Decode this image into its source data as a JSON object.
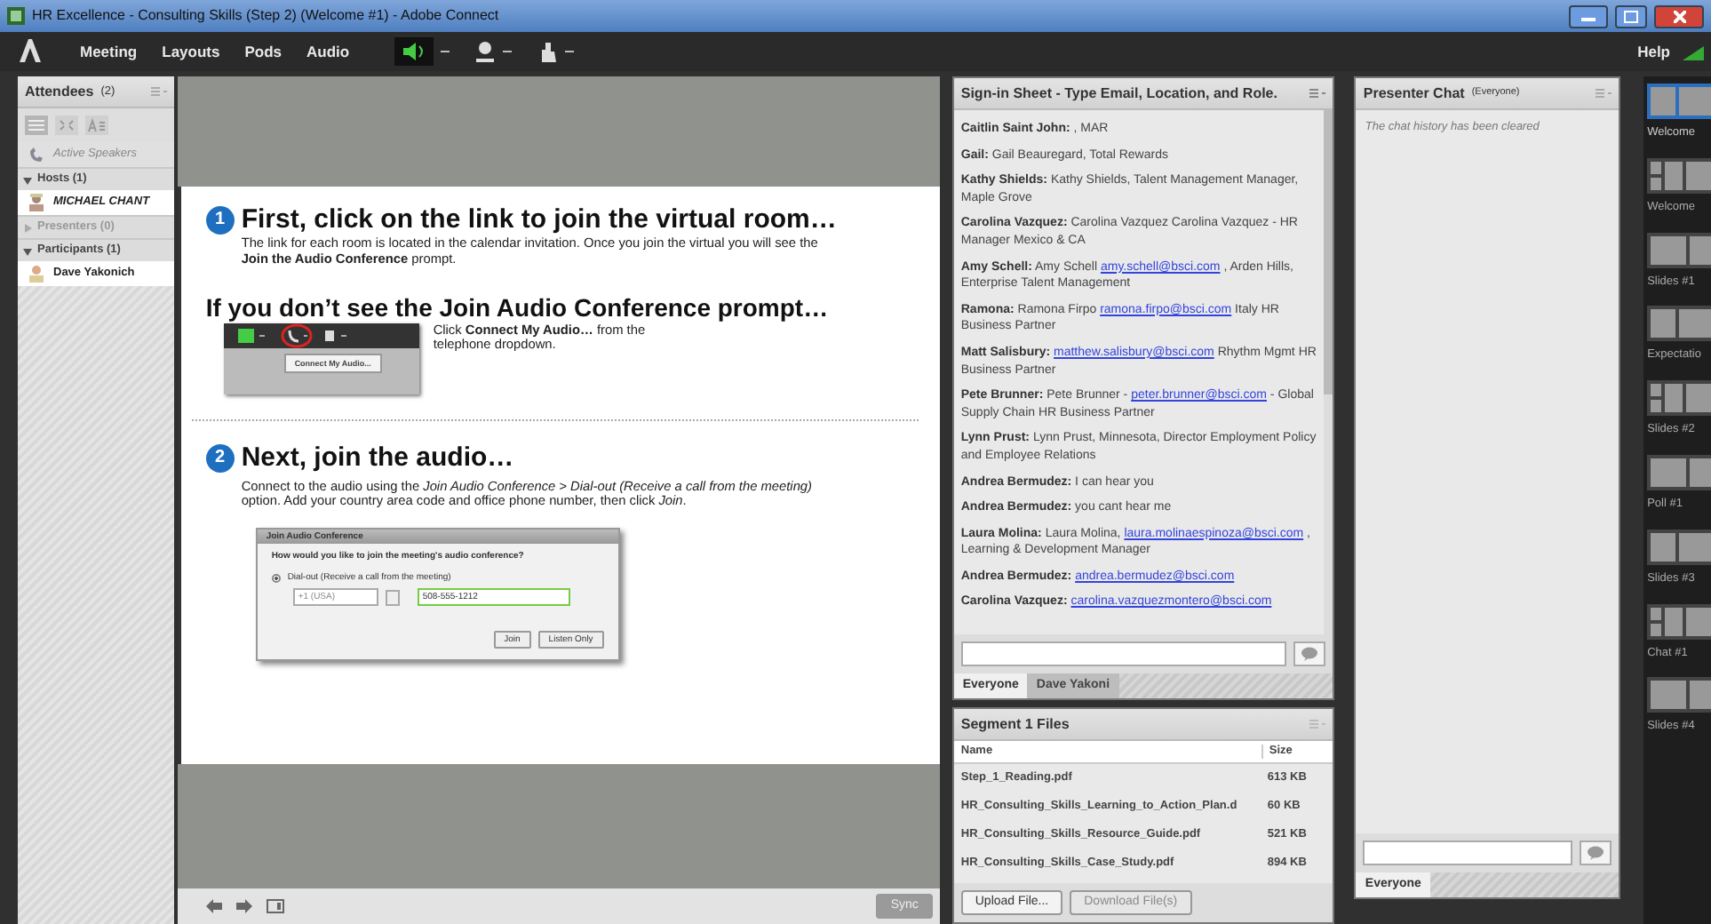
{
  "window": {
    "title": "HR Excellence - Consulting Skills (Step 2) (Welcome #1) - Adobe Connect"
  },
  "menu": [
    "Meeting",
    "Layouts",
    "Pods",
    "Audio"
  ],
  "help": "Help",
  "attendees": {
    "title": "Attendees",
    "count": "(2)",
    "active_speakers": "Active Speakers",
    "groups": [
      {
        "label": "Hosts (1)",
        "expanded": true,
        "children": [
          {
            "name": "MICHAEL CHANT",
            "kind": "host"
          }
        ]
      },
      {
        "label": "Presenters (0)",
        "expanded": false
      },
      {
        "label": "Participants (1)",
        "expanded": true,
        "children": [
          {
            "name": "Dave Yakonich",
            "kind": "participant"
          }
        ]
      }
    ]
  },
  "share": {
    "slide": {
      "step1": {
        "number": "1",
        "heading": "First, click on the link to join the virtual room…",
        "text": "The link for each room is located in the calendar invitation. Once you join the virtual you will see the  **Join the Audio Conference** prompt."
      },
      "prompt": {
        "heading": "If you don’t see the Join Audio Conference prompt…",
        "text": "Click **Connect My Audio…** from the telephone dropdown.",
        "menu_item": "Connect My Audio..."
      },
      "step2": {
        "number": "2",
        "heading": "Next, join the audio…",
        "text": "Connect to the audio using the *Join Audio Conference > Dial-out (Receive a call from the meeting)* option.  Add your country area code and office phone number, then click *Join*."
      },
      "dialog": {
        "title": "Join Audio Conference",
        "question": "How would you like to join the meeting's audio conference?",
        "option": {
          "label": "Dial-out (Receive a call from the meeting)",
          "selected": true
        },
        "country": "+1 (USA)",
        "phone": "508-555-1212",
        "buttons": [
          "Join",
          "Listen Only"
        ]
      }
    },
    "sync": "Sync"
  },
  "signin": {
    "title": "Sign-in Sheet - Type Email, Location, and Role.",
    "messages": [
      {
        "author": "Caitlin Saint John:",
        "text": " , MAR"
      },
      {
        "author": "Gail:",
        "text": " Gail Beauregard, Total Rewards"
      },
      {
        "author": "Kathy Shields:",
        "text": " Kathy Shields, Talent Management Manager, Maple Grove"
      },
      {
        "author": "Carolina Vazquez:",
        "text": " Carolina Vazquez Carolina Vazquez - HR Manager Mexico & CA"
      },
      {
        "author": "Amy Schell:",
        "text": " Amy Schell ",
        "email": "amy.schell@bsci.com",
        "after": " , Arden Hills, Enterprise Talent Management"
      },
      {
        "author": "Ramona:",
        "text": " Ramona Firpo ",
        "email": "ramona.firpo@bsci.com",
        "after": " Italy HR Business Partner"
      },
      {
        "author": "Matt Salisbury:",
        "email": "matthew.salisbury@bsci.com",
        "after": " Rhythm Mgmt HR Business Partner"
      },
      {
        "author": "Pete Brunner:",
        "text": " Pete Brunner - ",
        "email": "peter.brunner@bsci.com",
        "after": " - Global Supply Chain HR Business Partner"
      },
      {
        "author": "Lynn Prust:",
        "text": " Lynn Prust, Minnesota, Director Employment Policy and Employee Relations"
      },
      {
        "author": "Andrea Bermudez:",
        "text": " I can hear you"
      },
      {
        "author": "Andrea Bermudez:",
        "text": " you cant hear me"
      },
      {
        "author": "Laura Molina:",
        "text": " Laura Molina, ",
        "email": "laura.molinaespinoza@bsci.com",
        "after": " , Learning & Development Manager"
      },
      {
        "author": "Andrea Bermudez:",
        "email": "andrea.bermudez@bsci.com"
      },
      {
        "author": "Carolina Vazquez:",
        "email": "carolina.vazquezmontero@bsci.com"
      }
    ],
    "tabs": [
      {
        "label": "Everyone",
        "selected": true
      },
      {
        "label": "Dave Yakoni",
        "selected": false
      }
    ]
  },
  "files": {
    "title": "Segment 1 Files",
    "columns": [
      "Name",
      "Size"
    ],
    "rows": [
      [
        "Step_1_Reading.pdf",
        "613 KB"
      ],
      [
        "HR_Consulting_Skills_Learning_to_Action_Plan.d",
        "60 KB"
      ],
      [
        "HR_Consulting_Skills_Resource_Guide.pdf",
        "521 KB"
      ],
      [
        "HR_Consulting_Skills_Case_Study.pdf",
        "894 KB"
      ]
    ],
    "buttons": [
      {
        "label": "Upload File...",
        "disabled": false
      },
      {
        "label": "Download File(s)",
        "disabled": true
      }
    ]
  },
  "chat": {
    "title": "Presenter Chat",
    "scope": "(Everyone)",
    "notice": "The chat history has been cleared",
    "tabs": [
      {
        "label": "Everyone",
        "selected": true
      }
    ]
  },
  "layouts": [
    {
      "label": "Welcome",
      "selected": true
    },
    {
      "label": "Welcome",
      "selected": false
    },
    {
      "label": "Slides #1",
      "selected": false
    },
    {
      "label": "Expectatio",
      "selected": false
    },
    {
      "label": "Slides #2",
      "selected": false
    },
    {
      "label": "Poll #1",
      "selected": false
    },
    {
      "label": "Slides #3",
      "selected": false
    },
    {
      "label": "Chat #1",
      "selected": false
    },
    {
      "label": "Slides #4",
      "selected": false
    }
  ]
}
